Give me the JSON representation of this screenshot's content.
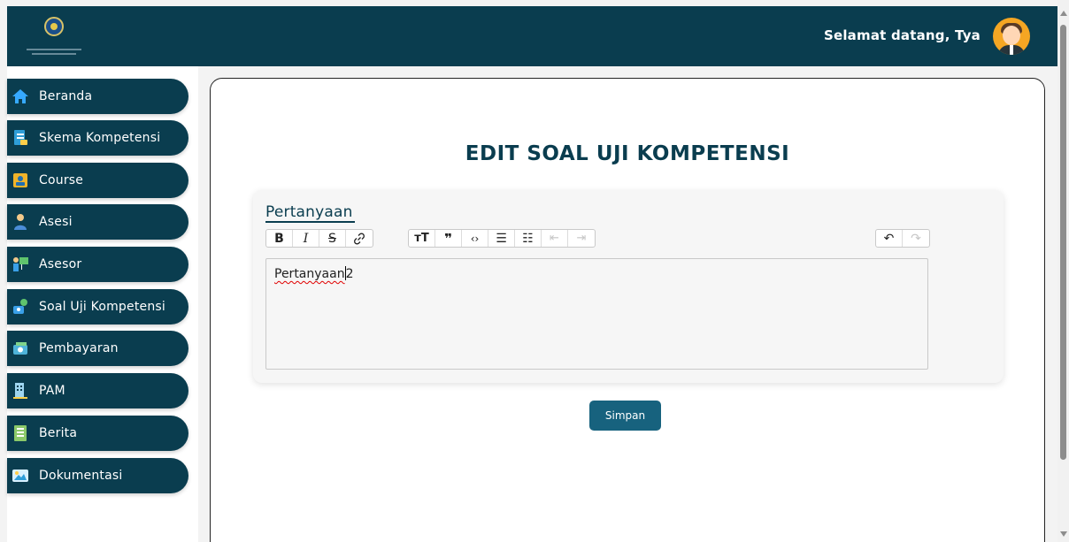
{
  "header": {
    "welcome_text": "Selamat datang, Tya",
    "background_color": "#0a3d4f"
  },
  "sidebar": {
    "items": [
      {
        "label": "Beranda",
        "icon": "home-icon"
      },
      {
        "label": "Skema Kompetensi",
        "icon": "document-icon"
      },
      {
        "label": "Course",
        "icon": "course-icon"
      },
      {
        "label": "Asesi",
        "icon": "user-icon"
      },
      {
        "label": "Asesor",
        "icon": "presenter-icon"
      },
      {
        "label": "Soal Uji Kompetensi",
        "icon": "exam-icon"
      },
      {
        "label": "Pembayaran",
        "icon": "money-icon"
      },
      {
        "label": "PAM",
        "icon": "building-icon"
      },
      {
        "label": "Berita",
        "icon": "news-icon"
      },
      {
        "label": "Dokumentasi",
        "icon": "image-icon"
      }
    ]
  },
  "main": {
    "title": "EDIT SOAL UJI KOMPETENSI",
    "editor": {
      "label": "Pertanyaan",
      "content_word": "Pertanyaan",
      "content_rest": "2",
      "toolbar_left": [
        "bold-icon",
        "italic-icon",
        "strikethrough-icon",
        "link-icon"
      ],
      "toolbar_middle": [
        "heading-icon",
        "quote-icon",
        "code-icon",
        "bullet-list-icon",
        "numbered-list-icon",
        "outdent-icon",
        "indent-icon"
      ],
      "toolbar_right": [
        "undo-icon",
        "redo-icon"
      ]
    },
    "save_label": "Simpan"
  },
  "colors": {
    "brand": "#0a3d4f",
    "button": "#17627e",
    "avatar_bg": "#f5a623"
  }
}
